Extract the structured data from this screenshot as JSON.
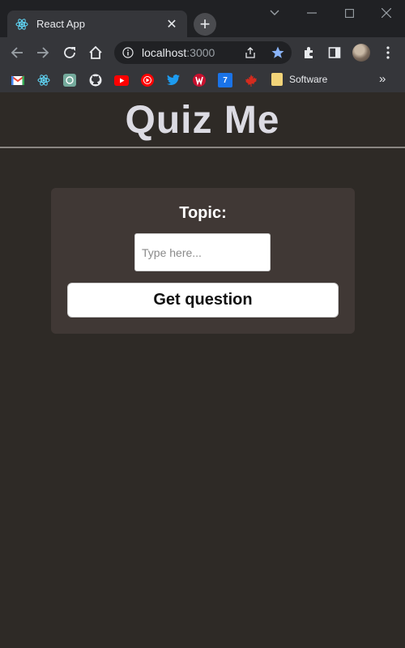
{
  "browser": {
    "tab": {
      "title": "React App",
      "favicon": "react-icon"
    },
    "address": {
      "host": "localhost",
      "port": ":3000"
    },
    "bookmarks": {
      "items": [
        {
          "name": "gmail-icon"
        },
        {
          "name": "react-icon"
        },
        {
          "name": "chatgpt-icon"
        },
        {
          "name": "github-icon"
        },
        {
          "name": "youtube-icon"
        },
        {
          "name": "youtube-music-icon"
        },
        {
          "name": "twitter-icon"
        },
        {
          "name": "uwaterloo-icon"
        },
        {
          "name": "calendar-icon",
          "label": "7"
        },
        {
          "name": "maple-leaf-icon"
        }
      ],
      "folder_label": "Software",
      "more_label": "»"
    }
  },
  "app": {
    "title": "Quiz Me",
    "topic_label": "Topic:",
    "topic_placeholder": "Type here...",
    "topic_value": "",
    "button_label": "Get question"
  },
  "colors": {
    "page_bg": "#2e2a26",
    "card_bg": "#403835",
    "title_color": "#dcdbe3",
    "star_accent": "#8ab4f8"
  }
}
